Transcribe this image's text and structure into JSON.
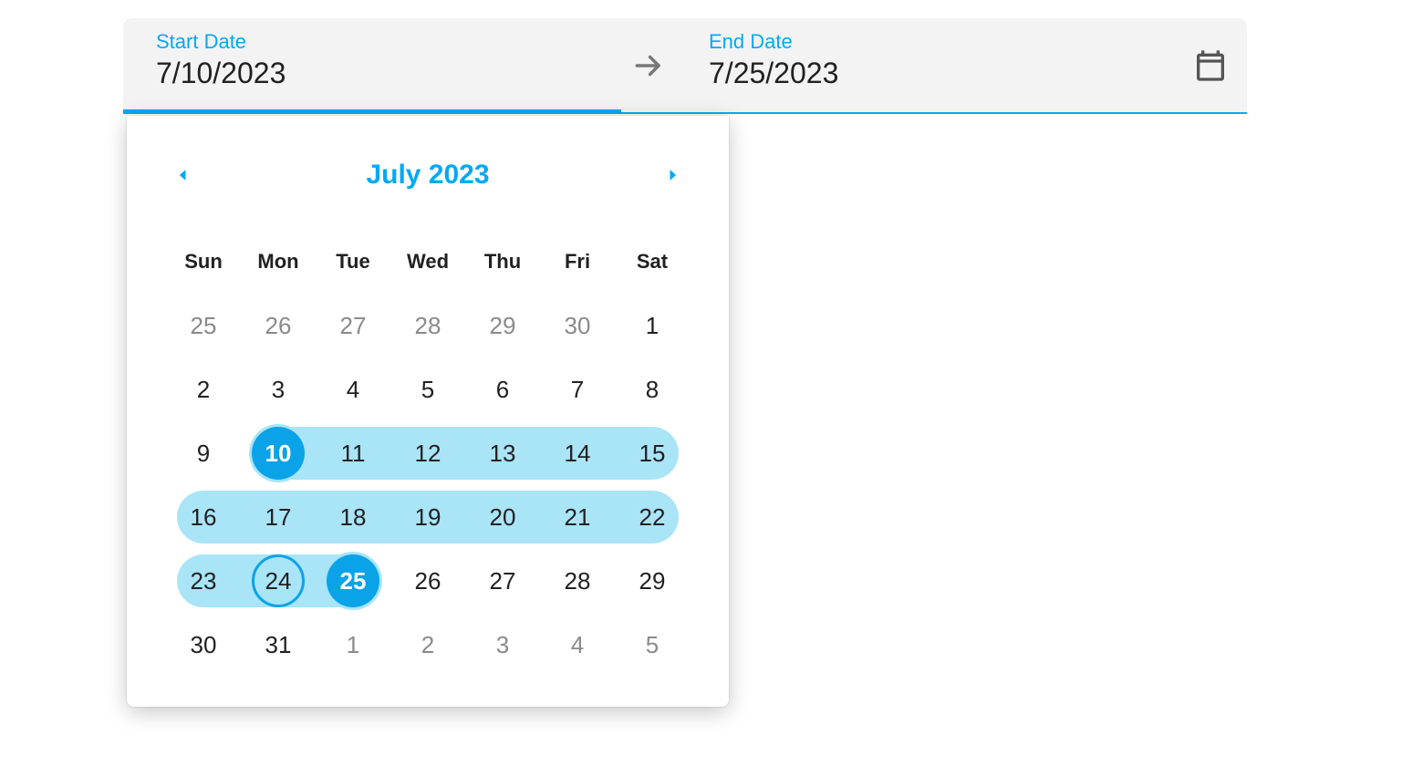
{
  "input": {
    "start": {
      "label": "Start Date",
      "value": "7/10/2023"
    },
    "end": {
      "label": "End Date",
      "value": "7/25/2023"
    },
    "active": "start"
  },
  "calendar": {
    "title": "July 2023",
    "weekdays": [
      "Sun",
      "Mon",
      "Tue",
      "Wed",
      "Thu",
      "Fri",
      "Sat"
    ],
    "selected_start": 10,
    "selected_end": 25,
    "today": 24,
    "weeks": [
      [
        {
          "n": 25,
          "cur": false
        },
        {
          "n": 26,
          "cur": false
        },
        {
          "n": 27,
          "cur": false
        },
        {
          "n": 28,
          "cur": false
        },
        {
          "n": 29,
          "cur": false
        },
        {
          "n": 30,
          "cur": false
        },
        {
          "n": 1,
          "cur": true
        }
      ],
      [
        {
          "n": 2,
          "cur": true
        },
        {
          "n": 3,
          "cur": true
        },
        {
          "n": 4,
          "cur": true
        },
        {
          "n": 5,
          "cur": true
        },
        {
          "n": 6,
          "cur": true
        },
        {
          "n": 7,
          "cur": true
        },
        {
          "n": 8,
          "cur": true
        }
      ],
      [
        {
          "n": 9,
          "cur": true
        },
        {
          "n": 10,
          "cur": true
        },
        {
          "n": 11,
          "cur": true
        },
        {
          "n": 12,
          "cur": true
        },
        {
          "n": 13,
          "cur": true
        },
        {
          "n": 14,
          "cur": true
        },
        {
          "n": 15,
          "cur": true
        }
      ],
      [
        {
          "n": 16,
          "cur": true
        },
        {
          "n": 17,
          "cur": true
        },
        {
          "n": 18,
          "cur": true
        },
        {
          "n": 19,
          "cur": true
        },
        {
          "n": 20,
          "cur": true
        },
        {
          "n": 21,
          "cur": true
        },
        {
          "n": 22,
          "cur": true
        }
      ],
      [
        {
          "n": 23,
          "cur": true
        },
        {
          "n": 24,
          "cur": true
        },
        {
          "n": 25,
          "cur": true
        },
        {
          "n": 26,
          "cur": true
        },
        {
          "n": 27,
          "cur": true
        },
        {
          "n": 28,
          "cur": true
        },
        {
          "n": 29,
          "cur": true
        }
      ],
      [
        {
          "n": 30,
          "cur": true
        },
        {
          "n": 31,
          "cur": true
        },
        {
          "n": 1,
          "cur": false
        },
        {
          "n": 2,
          "cur": false
        },
        {
          "n": 3,
          "cur": false
        },
        {
          "n": 4,
          "cur": false
        },
        {
          "n": 5,
          "cur": false
        }
      ]
    ]
  }
}
